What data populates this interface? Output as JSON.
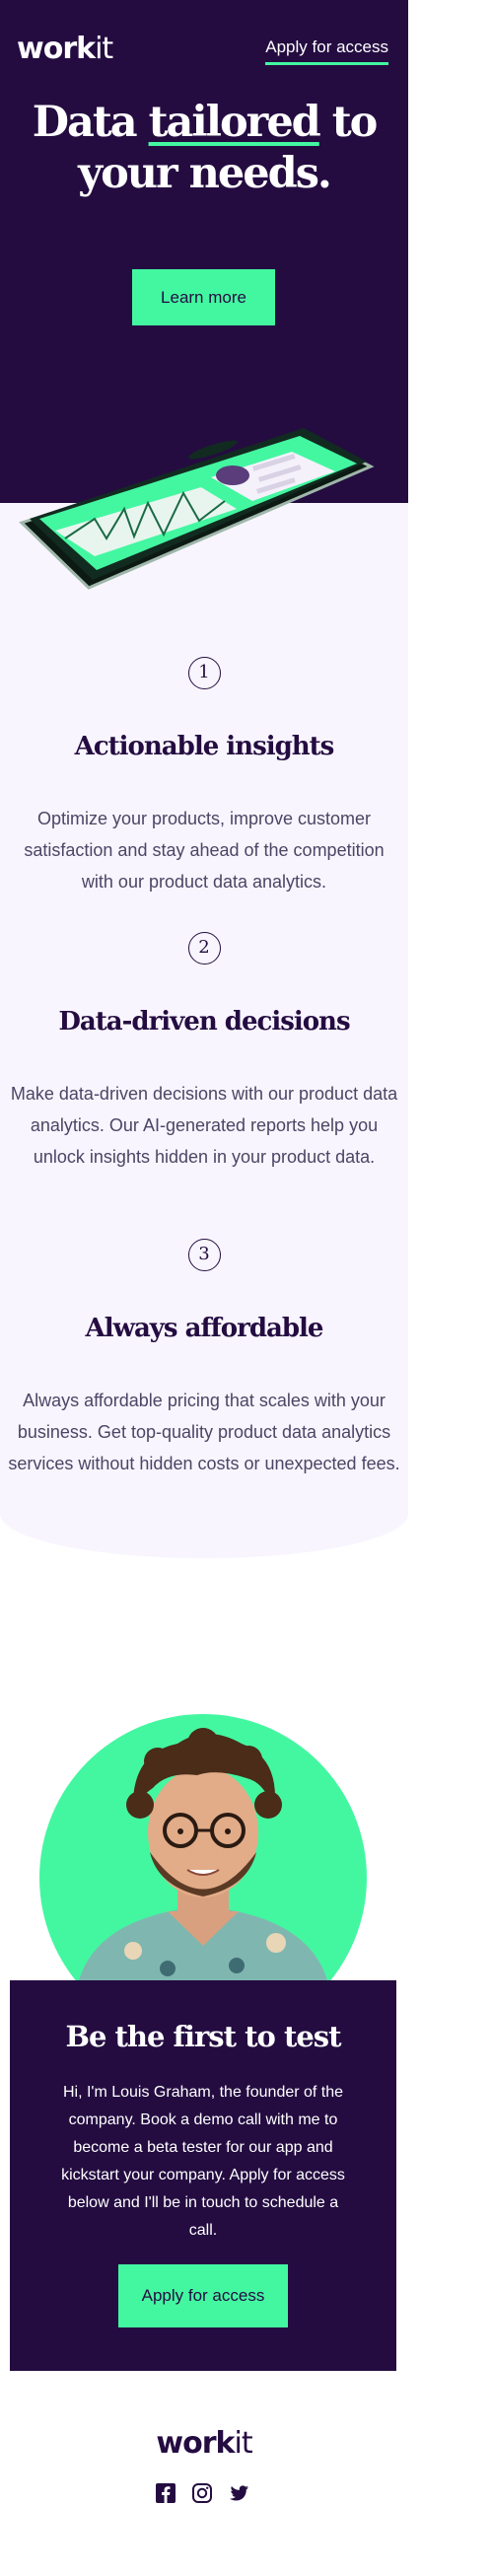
{
  "header": {
    "logo_bold": "work",
    "logo_light": "it",
    "apply_link": "Apply for access"
  },
  "hero": {
    "title_line1_start": "Data ",
    "title_line1_accent": "tailored",
    "title_line1_end": " to",
    "title_line2": "your needs.",
    "cta_label": "Learn more"
  },
  "features": [
    {
      "number": "1",
      "title": "Actionable insights",
      "text": "Optimize your products, improve customer satisfaction and stay ahead of the competition with our product data analytics."
    },
    {
      "number": "2",
      "title": "Data-driven decisions",
      "text": "Make data-driven decisions with our product data analytics. Our AI-generated reports help you unlock insights hidden in your product data."
    },
    {
      "number": "3",
      "title": "Always affordable",
      "text": "Always affordable pricing that scales with your business. Get top-quality product data analytics services without hidden costs or unexpected fees."
    }
  ],
  "cta": {
    "title": "Be the first to test",
    "text": "Hi, I'm Louis Graham, the founder of the company. Book a demo call with me to become a beta tester for our app and kickstart your company. Apply for access below and I'll be in touch to schedule a call.",
    "button_label": "Apply for access"
  },
  "footer": {
    "logo_bold": "work",
    "logo_light": "it",
    "social_icons": [
      "facebook-icon",
      "instagram-icon",
      "twitter-icon"
    ]
  },
  "colors": {
    "dark_purple": "#240c41",
    "accent_green": "#43f7a1",
    "light_lavender": "#f8f5fe",
    "body_text": "#4c4565"
  }
}
